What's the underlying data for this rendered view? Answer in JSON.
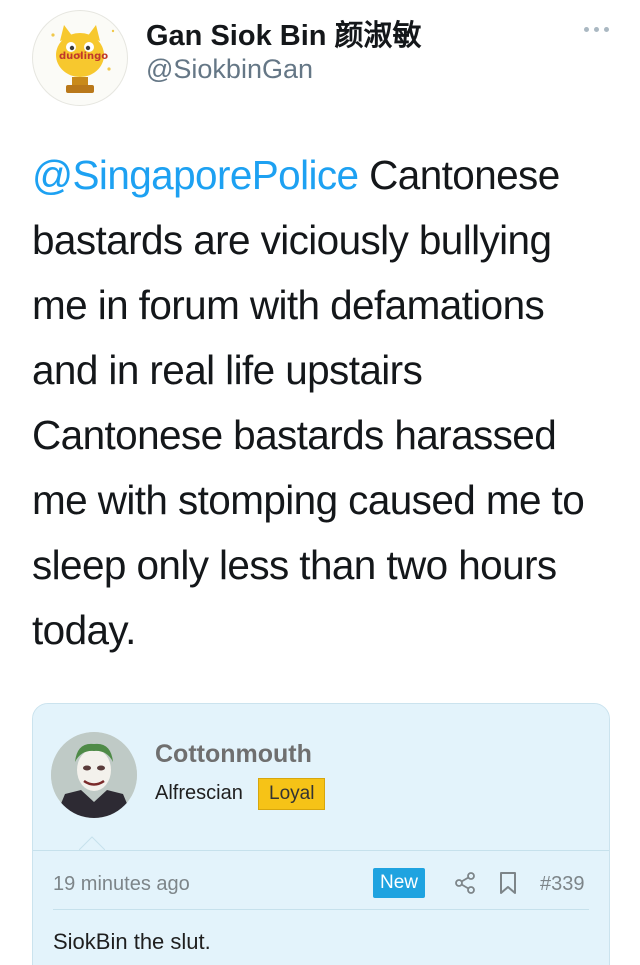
{
  "header": {
    "display_name": "Gan Siok Bin 颜淑敏",
    "handle": "@SiokbinGan",
    "avatar_logo_text": "duolingo",
    "more_icon": "more-horizontal-icon"
  },
  "tweet": {
    "mention": "@SingaporePolice",
    "text": " Cantonese bastards are viciously bullying me in forum with defamations and in real life upstairs Cantonese bastards harassed me with stomping caused me to sleep only less than two hours today."
  },
  "forum_card": {
    "username": "Cottonmouth",
    "role": "Alfrescian",
    "badge": "Loyal",
    "timestamp": "19 minutes ago",
    "new_label": "New",
    "share_icon": "share-icon",
    "bookmark_icon": "bookmark-icon",
    "post_number": "#339",
    "content": "SiokBin the slut."
  },
  "colors": {
    "mention": "#1da1f2",
    "card_background": "#e3f3fb",
    "badge_yellow": "#f6c317",
    "new_blue": "#1fa3e0"
  }
}
